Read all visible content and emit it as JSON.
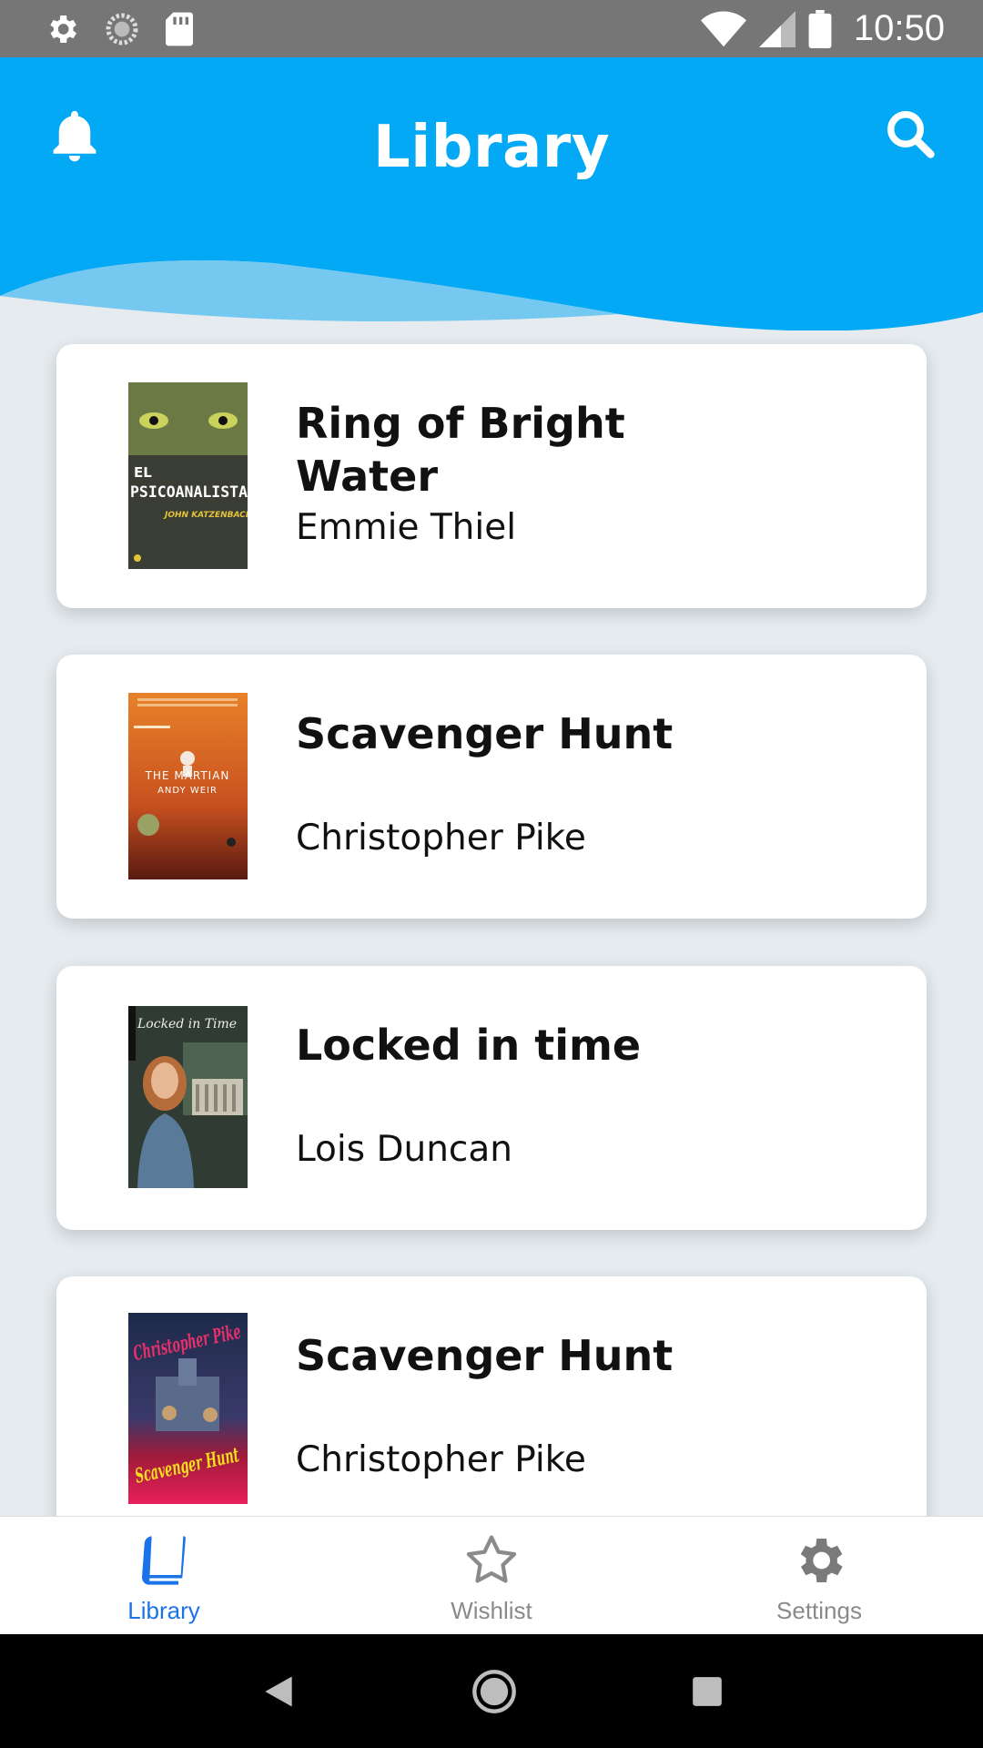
{
  "status_bar": {
    "time": "10:50",
    "left_icons": [
      "gear-icon",
      "sync-icon",
      "sd-card-icon"
    ],
    "right_icons": [
      "wifi-icon",
      "signal-icon",
      "battery-icon"
    ]
  },
  "header": {
    "title": "Library",
    "left_icon": "bell-icon",
    "right_icon": "search-icon",
    "color": "#03a9f4"
  },
  "books": [
    {
      "title": "Ring of Bright Water",
      "author": "Emmie Thiel",
      "cover_text": [
        "EL",
        "PSICOANALISTA",
        "JOHN KATZENBACH"
      ]
    },
    {
      "title": "Scavenger Hunt",
      "author": "Christopher Pike",
      "cover_text": [
        "THE MARTIAN",
        "ANDY WEIR"
      ]
    },
    {
      "title": "Locked in time",
      "author": "Lois Duncan",
      "cover_text": [
        "Locked in Time"
      ]
    },
    {
      "title": "Scavenger Hunt",
      "author": "Christopher Pike",
      "cover_text": [
        "Christopher Pike",
        "Scavenger Hunt"
      ]
    }
  ],
  "bottom_nav": {
    "items": [
      {
        "label": "Library",
        "icon": "book-icon",
        "active": true
      },
      {
        "label": "Wishlist",
        "icon": "star-icon",
        "active": false
      },
      {
        "label": "Settings",
        "icon": "gear-icon",
        "active": false
      }
    ],
    "active_color": "#1a73e8",
    "inactive_color": "#8a8a8a"
  },
  "system_nav": [
    "back-icon",
    "home-icon",
    "recents-icon"
  ]
}
